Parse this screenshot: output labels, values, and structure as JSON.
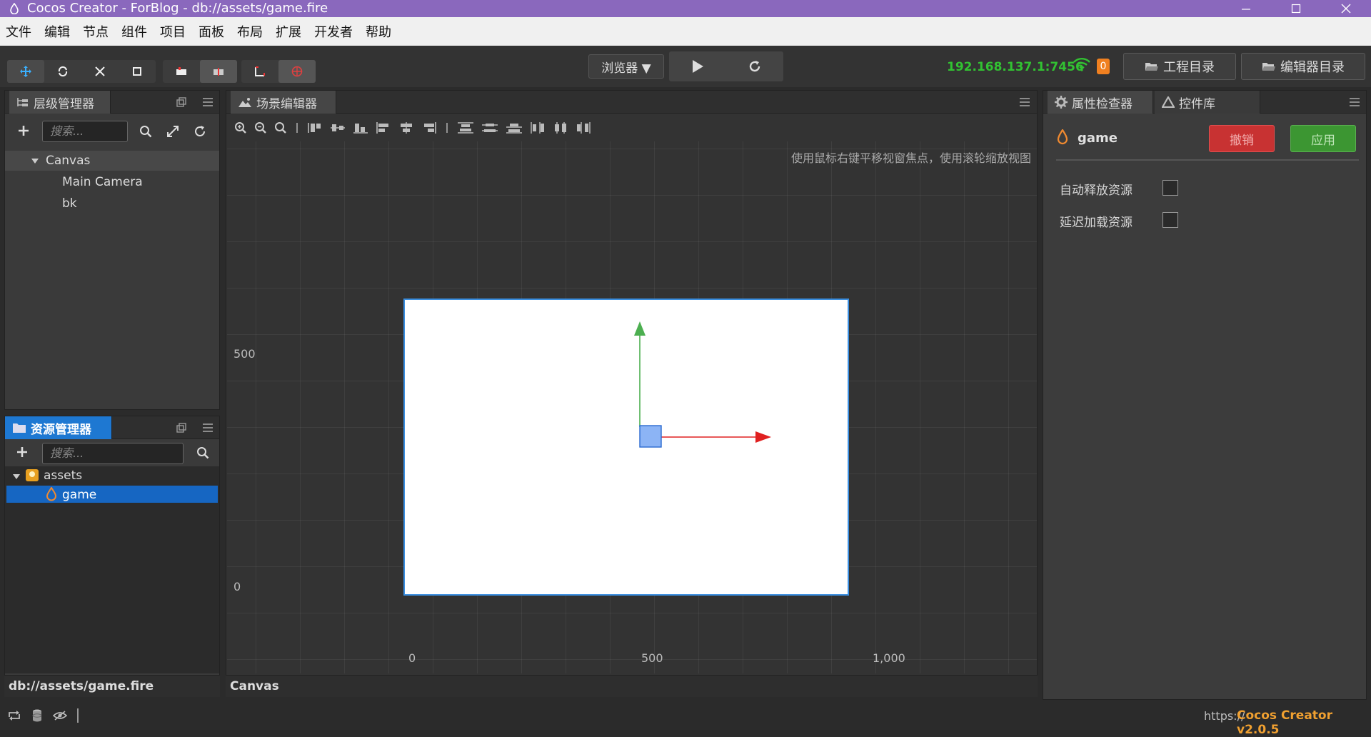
{
  "window": {
    "title": "Cocos Creator - ForBlog - db://assets/game.fire"
  },
  "menu": [
    "文件",
    "编辑",
    "节点",
    "组件",
    "项目",
    "面板",
    "布局",
    "扩展",
    "开发者",
    "帮助"
  ],
  "toolbar": {
    "preview_dropdown": "浏览器 ▼",
    "ip_address": "192.168.137.1:7456",
    "device_count": "0",
    "project_dir_button": "工程目录",
    "editor_dir_button": "编辑器目录"
  },
  "hierarchy": {
    "tab_label": "层级管理器",
    "search_placeholder": "搜索...",
    "nodes": {
      "canvas": "Canvas",
      "camera": "Main Camera",
      "bk": "bk"
    }
  },
  "assets": {
    "tab_label": "资源管理器",
    "search_placeholder": "搜索...",
    "root": "assets",
    "selected_item": "game",
    "path_status": "db://assets/game.fire"
  },
  "scene": {
    "tab_label": "场景编辑器",
    "hint": "使用鼠标右键平移视窗焦点，使用滚轮缩放视图",
    "y_label_500": "500",
    "y_label_0": "0",
    "x_label_0": "0",
    "x_label_500": "500",
    "x_label_1000": "1,000",
    "status_node": "Canvas"
  },
  "inspector": {
    "tab_label": "属性检查器",
    "library_tab_label": "控件库",
    "asset_name": "game",
    "revert_button": "撤销",
    "apply_button": "应用",
    "auto_release_label": "自动释放资源",
    "lazy_load_label": "延迟加载资源"
  },
  "statusbar": {
    "version": "Cocos Creator v2.0.5",
    "url_fragment": "https://"
  },
  "colors": {
    "titlebar": "#8a68bd",
    "selection": "#1e78d2",
    "revert": "#c83232",
    "apply": "#3c9632",
    "ip": "#32c232",
    "version": "#f0a030"
  }
}
